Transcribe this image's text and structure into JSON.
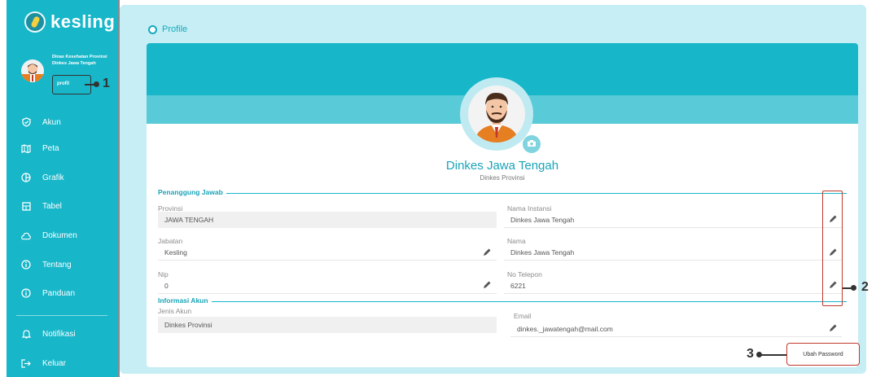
{
  "app": {
    "logo_text": "kesling"
  },
  "sidebar": {
    "user_name": "Dinas Kesehatan Provinsi Dinkes Jawa Tengah",
    "profil_link": "profil",
    "items": [
      {
        "label": "Akun",
        "icon": "shield-icon"
      },
      {
        "label": "Peta",
        "icon": "map-icon"
      },
      {
        "label": "Grafik",
        "icon": "chart-pie-icon"
      },
      {
        "label": "Tabel",
        "icon": "table-icon"
      },
      {
        "label": "Dokumen",
        "icon": "cloud-icon"
      },
      {
        "label": "Tentang",
        "icon": "info-icon"
      },
      {
        "label": "Panduan",
        "icon": "info-icon"
      }
    ],
    "bottom_items": [
      {
        "label": "Notifikasi",
        "icon": "bell-icon"
      },
      {
        "label": "Keluar",
        "icon": "logout-icon"
      }
    ]
  },
  "page": {
    "title": "Profile"
  },
  "profile": {
    "name": "Dinkes Jawa Tengah",
    "role": "Dinkes Provinsi"
  },
  "sections": {
    "penanggung_jawab": "Penanggung Jawab",
    "informasi_akun": "Informasi Akun"
  },
  "fields": {
    "provinsi": {
      "label": "Provinsi",
      "value": "JAWA TENGAH"
    },
    "jabatan": {
      "label": "Jabatan",
      "value": "Kesling"
    },
    "nip": {
      "label": "Nip",
      "value": "0"
    },
    "nama_instansi": {
      "label": "Nama Instansi",
      "value": "Dinkes Jawa Tengah"
    },
    "nama": {
      "label": "Nama",
      "value": "Dinkes Jawa Tengah"
    },
    "no_telepon": {
      "label": "No Telepon",
      "value": "6221"
    },
    "jenis_akun": {
      "label": "Jenis Akun",
      "value": "Dinkes Provinsi"
    },
    "email": {
      "label": "Email",
      "value": "dinkes._jawatengah@mail.com"
    }
  },
  "actions": {
    "ubah_password": "Ubah Password"
  },
  "annotations": {
    "one": "1",
    "two": "2",
    "three": "3"
  },
  "colors": {
    "primary": "#17b6c9",
    "accent_text": "#1aa4b8",
    "annotation": "#c0392b"
  }
}
